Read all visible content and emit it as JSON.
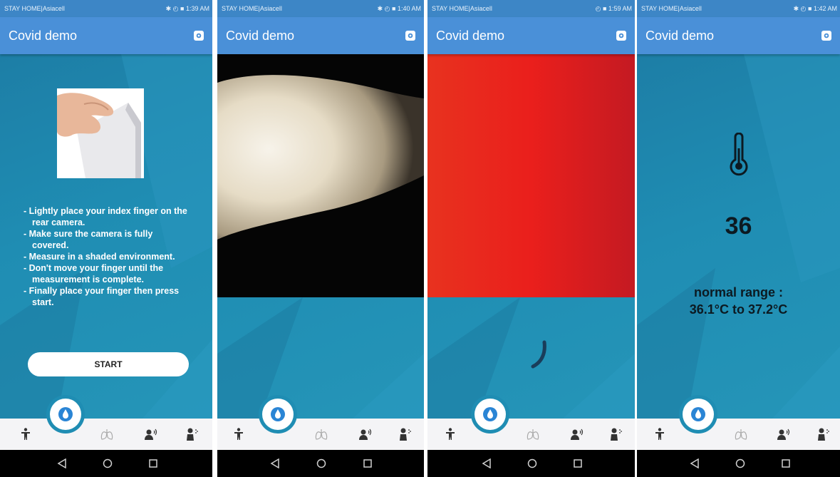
{
  "screens": [
    {
      "carrier": "STAY HOME|Asiacell",
      "time": "1:39 AM",
      "app_title": "Covid demo"
    },
    {
      "carrier": "STAY HOME|Asiacell",
      "time": "1:40 AM",
      "app_title": "Covid demo"
    },
    {
      "carrier": "STAY HOME|Asiacell",
      "time": "1:59 AM",
      "app_title": "Covid demo"
    },
    {
      "carrier": "STAY HOME|Asiacell",
      "time": "1:42 AM",
      "app_title": "Covid demo"
    }
  ],
  "instructions": [
    "- Lightly place your index finger on the rear camera.",
    "- Make sure the camera is fully covered.",
    "- Measure in a shaded environment.",
    "- Don't move your finger until the measurement is complete.",
    "- Finally place your finger then press start."
  ],
  "start_label": "START",
  "result": {
    "value": "36",
    "range_line1": "normal range :",
    "range_line2": "36.1°C to 37.2°C"
  },
  "icons": {
    "settings": "settings-icon",
    "nav": [
      "person-icon",
      "blood-drop-icon",
      "lungs-icon",
      "cough-icon",
      "sneeze-icon"
    ],
    "system": [
      "back-icon",
      "home-icon",
      "recents-icon"
    ],
    "temperature": "thermometer-icon"
  },
  "colors": {
    "status_bar": "#3d86c6",
    "app_bar": "#4a90d8",
    "content_bg": "#1f8db3",
    "measure_red": "#e8241c"
  }
}
